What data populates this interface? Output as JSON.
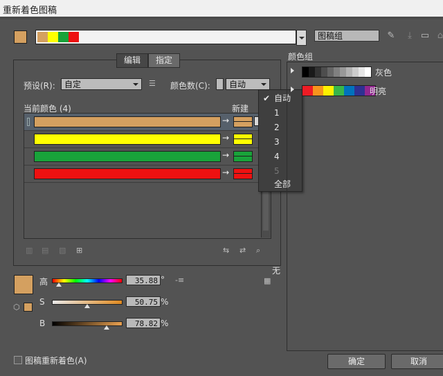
{
  "window": {
    "title": "重新着色图稿"
  },
  "top": {
    "main_swatch_color": "#d4a060",
    "harmony_colors": [
      "#d4a060",
      "#ffff00",
      "#19a33a",
      "#ee1111"
    ],
    "group_name": "图稿组"
  },
  "tabs": [
    {
      "label": "编辑"
    },
    {
      "label": "指定"
    }
  ],
  "controls": {
    "preset_label": "预设(R):",
    "preset_value": "自定",
    "color_count_label": "颜色数(C):",
    "color_count_value": "自动",
    "current_colors_label": "当前颜色 (4)",
    "new_label": "新建"
  },
  "color_rows": [
    {
      "current": "#d4a060",
      "new": "#d4a060",
      "selected": true
    },
    {
      "current": "#ffff00",
      "new": "#ffff00",
      "selected": false
    },
    {
      "current": "#19a33a",
      "new": "#19a33a",
      "selected": false
    },
    {
      "current": "#ee1111",
      "new": "#ee1111",
      "selected": false
    }
  ],
  "color_count_menu": [
    {
      "label": "自动",
      "checked": true,
      "disabled": false
    },
    {
      "label": "1",
      "checked": false,
      "disabled": false
    },
    {
      "label": "2",
      "checked": false,
      "disabled": false
    },
    {
      "label": "3",
      "checked": false,
      "disabled": false
    },
    {
      "label": "4",
      "checked": false,
      "disabled": false
    },
    {
      "label": "5",
      "checked": false,
      "disabled": true
    },
    {
      "label": "全部",
      "checked": false,
      "disabled": false
    }
  ],
  "sliders": {
    "h": {
      "label": "高",
      "value": "35.88",
      "unit": "°",
      "fraction": 0.1
    },
    "s": {
      "label": "S",
      "value": "50.75",
      "unit": "%",
      "fraction": 0.5075
    },
    "b": {
      "label": "B",
      "value": "78.82",
      "unit": "%",
      "fraction": 0.7882
    },
    "none_label": "无"
  },
  "color_groups": {
    "header": "颜色组",
    "groups": [
      {
        "name": "灰色",
        "colors": [
          "#000000",
          "#1a1a1a",
          "#333333",
          "#4d4d4d",
          "#666666",
          "#808080",
          "#999999",
          "#b3b3b3",
          "#cccccc",
          "#e6e6e6",
          "#ffffff"
        ]
      },
      {
        "name": "明亮",
        "colors": [
          "#ee1c25",
          "#f7941d",
          "#fff200",
          "#39b54a",
          "#0072bc",
          "#2e3192",
          "#92278f"
        ]
      }
    ]
  },
  "footer": {
    "recolor_checkbox_label": "图稿重新着色(A)",
    "ok_label": "确定",
    "cancel_label": "取消"
  }
}
